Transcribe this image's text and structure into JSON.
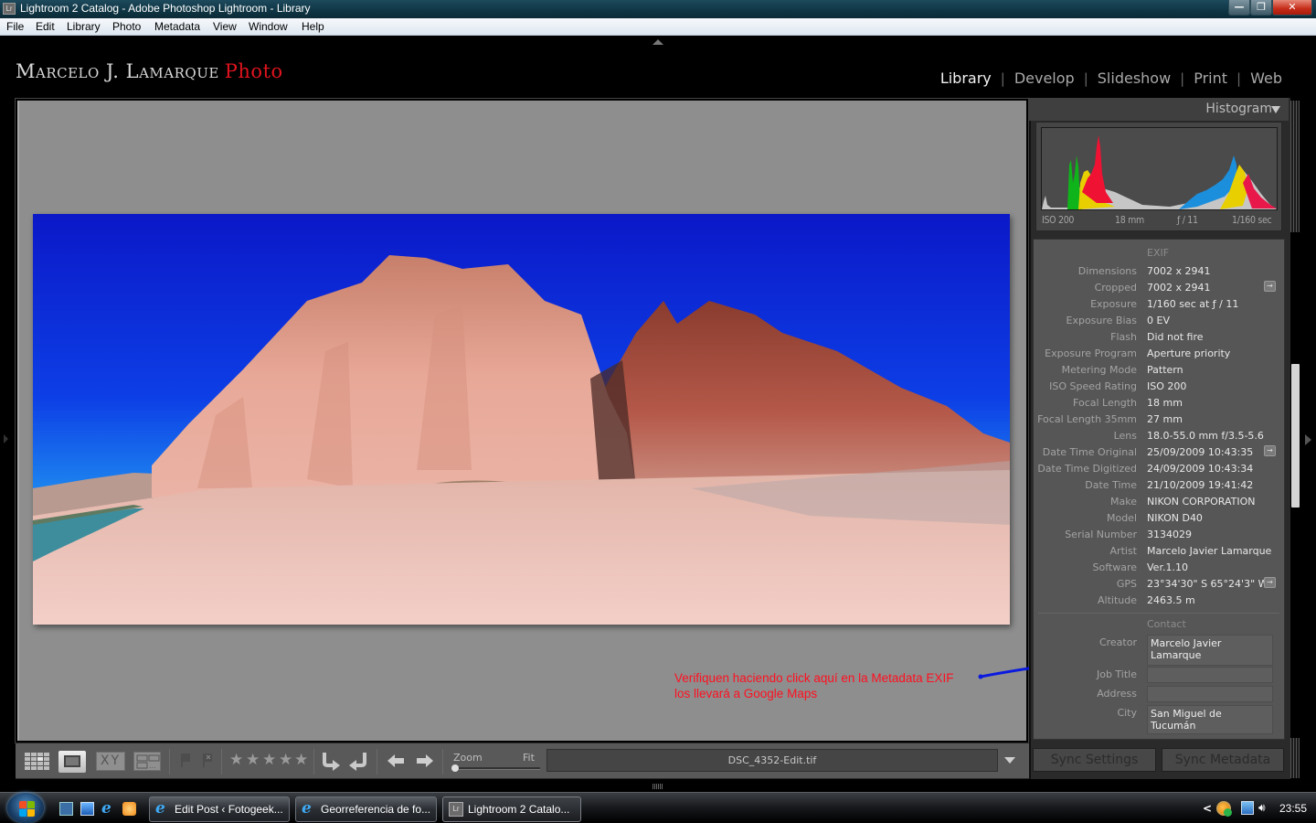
{
  "window": {
    "title": "Lightroom 2 Catalog - Adobe Photoshop Lightroom - Library",
    "app_badge": "Lr",
    "controls": {
      "minimize": "—",
      "maximize": "❐",
      "close": "✕"
    }
  },
  "menu": [
    "File",
    "Edit",
    "Library",
    "Photo",
    "Metadata",
    "View",
    "Window",
    "Help"
  ],
  "identity_plate": {
    "name": "Marcelo J. Lamarque",
    "accent": "Photo",
    "accent_color": "#e0141e"
  },
  "modules": {
    "active": "Library",
    "items": [
      "Library",
      "Develop",
      "Slideshow",
      "Print",
      "Web"
    ]
  },
  "histogram": {
    "title": "Histogram",
    "iso": "ISO 200",
    "focal": "18 mm",
    "aperture": "ƒ / 11",
    "shutter": "1/160 sec"
  },
  "metadata": {
    "exif_header": "EXIF",
    "exif": [
      {
        "label": "Dimensions",
        "value": "7002 x 2941"
      },
      {
        "label": "Cropped",
        "value": "7002 x 2941",
        "goto": true
      },
      {
        "label": "Exposure",
        "value": "1/160 sec at ƒ / 11"
      },
      {
        "label": "Exposure Bias",
        "value": "0 EV"
      },
      {
        "label": "Flash",
        "value": "Did not fire"
      },
      {
        "label": "Exposure Program",
        "value": "Aperture priority"
      },
      {
        "label": "Metering Mode",
        "value": "Pattern"
      },
      {
        "label": "ISO Speed Rating",
        "value": "ISO 200"
      },
      {
        "label": "Focal Length",
        "value": "18 mm"
      },
      {
        "label": "Focal Length 35mm",
        "value": "27 mm"
      },
      {
        "label": "Lens",
        "value": "18.0-55.0 mm f/3.5-5.6"
      },
      {
        "label": "Date Time Original",
        "value": "25/09/2009 10:43:35",
        "goto": true
      },
      {
        "label": "Date Time Digitized",
        "value": "24/09/2009 10:43:34"
      },
      {
        "label": "Date Time",
        "value": "21/10/2009 19:41:42"
      },
      {
        "label": "Make",
        "value": "NIKON CORPORATION"
      },
      {
        "label": "Model",
        "value": "NIKON D40"
      },
      {
        "label": "Serial Number",
        "value": "3134029"
      },
      {
        "label": "Artist",
        "value": "Marcelo Javier Lamarque"
      },
      {
        "label": "Software",
        "value": "Ver.1.10"
      },
      {
        "label": "GPS",
        "value": "23°34'30\" S 65°24'3\" W",
        "goto": true
      },
      {
        "label": "Altitude",
        "value": "2463.5 m"
      }
    ],
    "contact_header": "Contact",
    "contact": [
      {
        "label": "Creator",
        "value": "Marcelo Javier Lamarque"
      },
      {
        "label": "Job Title",
        "value": ""
      },
      {
        "label": "Address",
        "value": ""
      },
      {
        "label": "City",
        "value": "San Miguel de Tucumán"
      }
    ],
    "goto_glyph": "→"
  },
  "annotation": {
    "line1": "Verifiquen haciendo click aquí en la Metadata EXIF",
    "line2": "los llevará a Google Maps",
    "color": "#ff1020",
    "arrow_color": "#0a1adf"
  },
  "toolbar": {
    "view_modes": [
      "grid-view",
      "loupe-view",
      "compare-view",
      "survey-view"
    ],
    "compare_label": "XY",
    "rating_stars": 0,
    "stars_total": 5,
    "zoom_label": "Zoom",
    "fit_label": "Fit",
    "filename": "DSC_4352-Edit.tif"
  },
  "sync": {
    "settings": "Sync Settings",
    "metadata": "Sync Metadata"
  },
  "taskbar": {
    "tasks": [
      {
        "label": "Edit Post ‹ Fotogeek...",
        "icon": "ie-icon"
      },
      {
        "label": "Georreferencia de fo...",
        "icon": "ie-icon"
      },
      {
        "label": "Lightroom 2 Catalo...",
        "icon": "lightroom-icon",
        "active": true
      }
    ],
    "tray_chevron": "<",
    "clock": "23:55"
  }
}
